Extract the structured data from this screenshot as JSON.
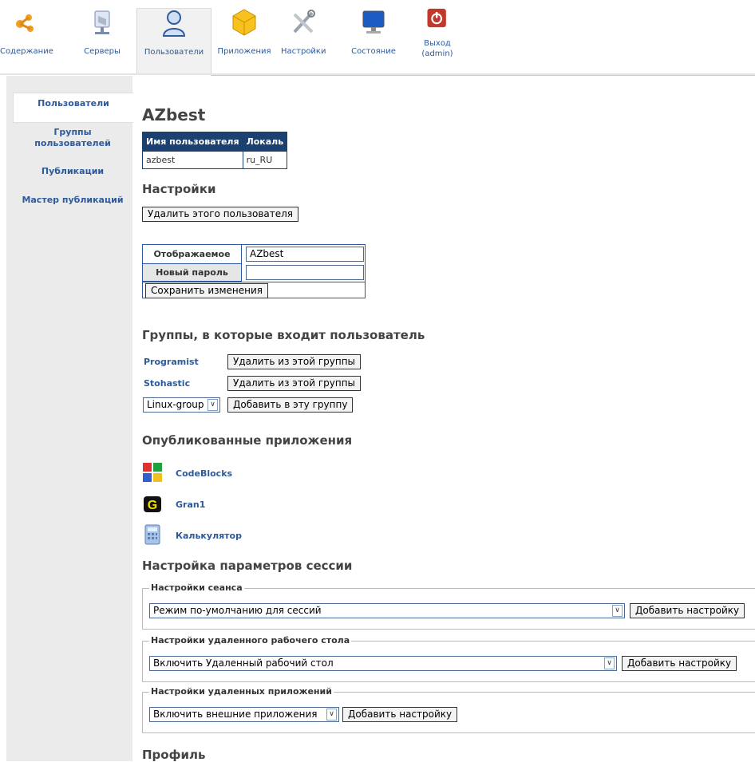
{
  "nav": {
    "items": [
      {
        "label": "Содержание",
        "icon": "content-icon"
      },
      {
        "label": "Серверы",
        "icon": "server-icon"
      },
      {
        "label": "Пользователи",
        "icon": "user-icon"
      },
      {
        "label": "Приложения",
        "icon": "applications-icon"
      },
      {
        "label": "Настройки",
        "icon": "settings-icon"
      },
      {
        "label": "Состояние",
        "icon": "monitor-icon"
      },
      {
        "label1": "Выход",
        "label2": "(admin)",
        "icon": "power-icon"
      }
    ]
  },
  "sidebar": {
    "items": [
      {
        "label": "Пользователи"
      },
      {
        "label1": "Группы",
        "label2": "пользователей"
      },
      {
        "label": "Публикации"
      },
      {
        "label": "Мастер публикаций"
      }
    ]
  },
  "user": {
    "title": "AZbest",
    "table_headers": [
      "Имя пользователя",
      "Локаль"
    ],
    "table_row": [
      "azbest",
      "ru_RU"
    ]
  },
  "settings": {
    "heading": "Настройки",
    "delete_label": "Удалить этого пользователя",
    "display_name_label": "Отображаемое имя",
    "display_name_value": "AZbest",
    "new_password_label": "Новый пароль",
    "new_password_value": "",
    "save_label": "Сохранить изменения"
  },
  "groups": {
    "heading": "Группы, в которые входит пользователь",
    "items": [
      {
        "name": "Programist",
        "remove_label": "Удалить из этой группы"
      },
      {
        "name": "Stohastic",
        "remove_label": "Удалить из этой группы"
      }
    ],
    "select_value": "Linux-group",
    "add_label": "Добавить в эту группу"
  },
  "apps": {
    "heading": "Опубликованные приложения",
    "items": [
      {
        "name": "CodeBlocks",
        "icon": "codeblocks-icon"
      },
      {
        "name": "Gran1",
        "icon": "gran-icon"
      },
      {
        "name": "Калькулятор",
        "icon": "calculator-icon"
      }
    ]
  },
  "session": {
    "heading": "Настройка параметров сессии",
    "groups": [
      {
        "legend": "Настройки сеанса",
        "select_value": "Режим по-умолчанию для сессий",
        "add_label": "Добавить настройку"
      },
      {
        "legend": "Настройки удаленного рабочего стола",
        "select_value": "Включить Удаленный рабочий стол",
        "add_label": "Добавить настройку"
      },
      {
        "legend": "Настройки удаленных приложений",
        "select_value": "Включить внешние приложения",
        "add_label": "Добавить настройку"
      }
    ]
  },
  "profile": {
    "heading": "Профиль"
  }
}
